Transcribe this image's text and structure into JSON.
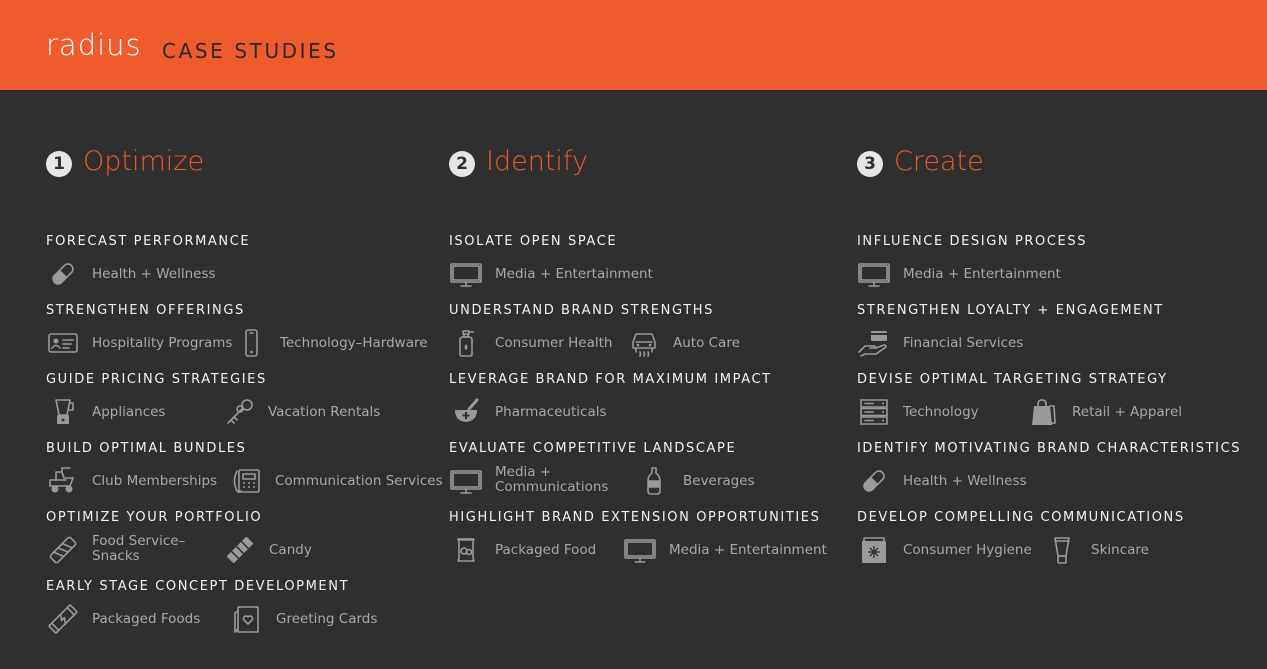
{
  "header": {
    "logo": "radius",
    "title": "CASE STUDIES"
  },
  "columns": [
    {
      "number": "1",
      "title": "Optimize",
      "sections": [
        {
          "title": "FORECAST PERFORMANCE",
          "items": [
            {
              "label": "Health + Wellness",
              "icon": "pill-icon"
            }
          ]
        },
        {
          "title": "STRENGTHEN OFFERINGS",
          "items": [
            {
              "label": "Hospitality Programs",
              "icon": "id-card-icon"
            },
            {
              "label": "Technology–Hardware",
              "icon": "phone-icon"
            }
          ]
        },
        {
          "title": "GUIDE PRICING STRATEGIES",
          "items": [
            {
              "label": "Appliances",
              "icon": "blender-icon"
            },
            {
              "label": "Vacation Rentals",
              "icon": "keys-icon"
            }
          ]
        },
        {
          "title": "BUILD OPTIMAL BUNDLES",
          "items": [
            {
              "label": "Club Memberships",
              "icon": "golf-cart-icon"
            },
            {
              "label": "Communication Services",
              "icon": "desk-phone-icon"
            }
          ]
        },
        {
          "title": "OPTIMIZE YOUR PORTFOLIO",
          "items": [
            {
              "label": "Food Service–\nSnacks",
              "icon": "snack-bar-icon"
            },
            {
              "label": "Candy",
              "icon": "candy-bar-icon"
            }
          ]
        },
        {
          "title": "EARLY STAGE CONCEPT DEVELOPMENT",
          "items": [
            {
              "label": "Packaged Foods",
              "icon": "energy-bar-icon"
            },
            {
              "label": "Greeting Cards",
              "icon": "greeting-card-icon"
            }
          ]
        }
      ]
    },
    {
      "number": "2",
      "title": "Identify",
      "sections": [
        {
          "title": "ISOLATE OPEN SPACE",
          "items": [
            {
              "label": "Media + Entertainment",
              "icon": "monitor-icon"
            }
          ]
        },
        {
          "title": "UNDERSTAND BRAND STRENGTHS",
          "items": [
            {
              "label": "Consumer Health",
              "icon": "sanitizer-bottle-icon"
            },
            {
              "label": "Auto Care",
              "icon": "car-wash-icon"
            }
          ]
        },
        {
          "title": "LEVERAGE BRAND FOR MAXIMUM IMPACT",
          "items": [
            {
              "label": "Pharmaceuticals",
              "icon": "mortar-pestle-icon"
            }
          ]
        },
        {
          "title": "EVALUATE COMPETITIVE LANDSCAPE",
          "items": [
            {
              "label": "Media +\nCommunications",
              "icon": "monitor-icon"
            },
            {
              "label": "Beverages",
              "icon": "bottle-icon"
            }
          ]
        },
        {
          "title": "HIGHLIGHT BRAND EXTENSION OPPORTUNITIES",
          "items": [
            {
              "label": "Packaged Food",
              "icon": "snack-bag-icon"
            },
            {
              "label": "Media + Entertainment",
              "icon": "monitor-icon"
            }
          ]
        }
      ]
    },
    {
      "number": "3",
      "title": "Create",
      "sections": [
        {
          "title": "INFLUENCE DESIGN PROCESS",
          "items": [
            {
              "label": "Media + Entertainment",
              "icon": "monitor-icon"
            }
          ]
        },
        {
          "title": "STRENGTHEN LOYALTY + ENGAGEMENT",
          "items": [
            {
              "label": "Financial Services",
              "icon": "hand-card-icon"
            }
          ]
        },
        {
          "title": "DEVISE OPTIMAL TARGETING STRATEGY",
          "items": [
            {
              "label": "Technology",
              "icon": "server-icon"
            },
            {
              "label": "Retail + Apparel",
              "icon": "shopping-bag-icon"
            }
          ]
        },
        {
          "title": "IDENTIFY MOTIVATING BRAND CHARACTERISTICS",
          "items": [
            {
              "label": "Health + Wellness",
              "icon": "pill-icon"
            }
          ]
        },
        {
          "title": "DEVELOP COMPELLING COMMUNICATIONS",
          "items": [
            {
              "label": "Consumer Hygiene",
              "icon": "detergent-box-icon"
            },
            {
              "label": "Skincare",
              "icon": "lotion-tube-icon"
            }
          ]
        }
      ]
    }
  ],
  "colors": {
    "accent": "#ef5b2c",
    "background": "#2f2f2f",
    "text": "#f2f2f2",
    "muted": "#a8a8a8"
  }
}
